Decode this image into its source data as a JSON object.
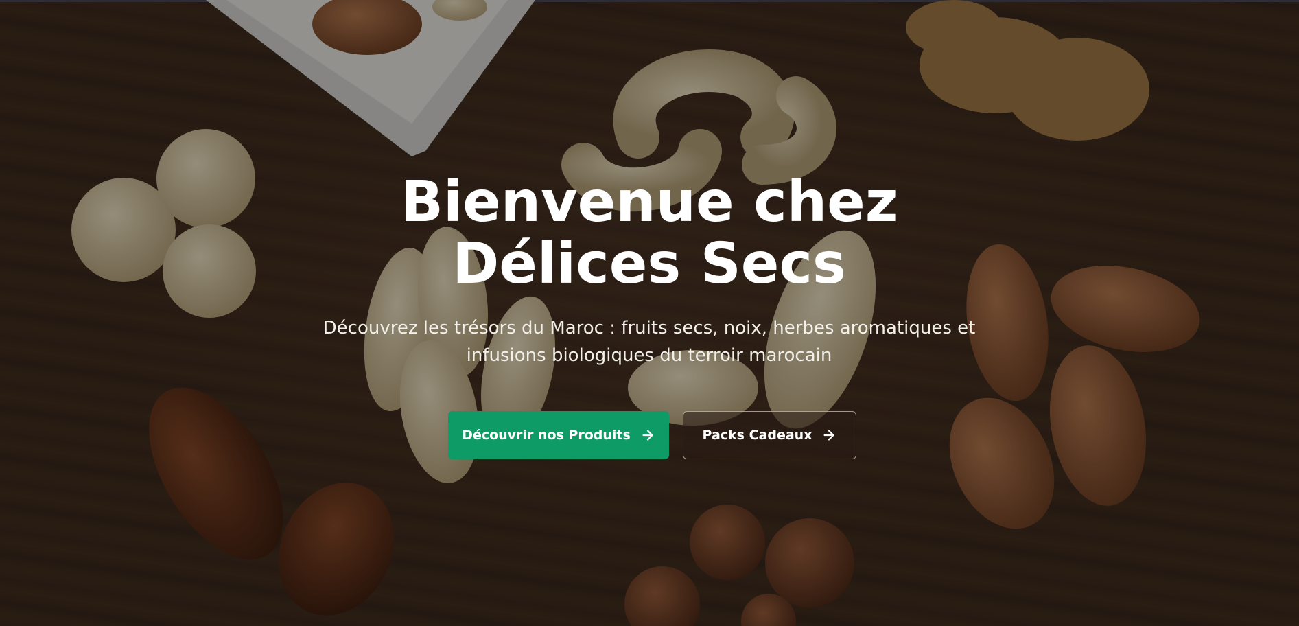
{
  "hero": {
    "title": "Bienvenue chez Délices Secs",
    "subtitle": "Découvrez les trésors du Maroc : fruits secs, noix, herbes aromatiques et infusions biologiques du terroir marocain",
    "buttons": {
      "primary_label": "Découvrir nos Produits",
      "secondary_label": "Packs Cadeaux"
    }
  },
  "icons": {
    "button_icon": "arrow-right-icon"
  },
  "colors": {
    "primary_button": "#0f9b66",
    "text": "#ffffff",
    "background_wood": "#3f2b20"
  }
}
